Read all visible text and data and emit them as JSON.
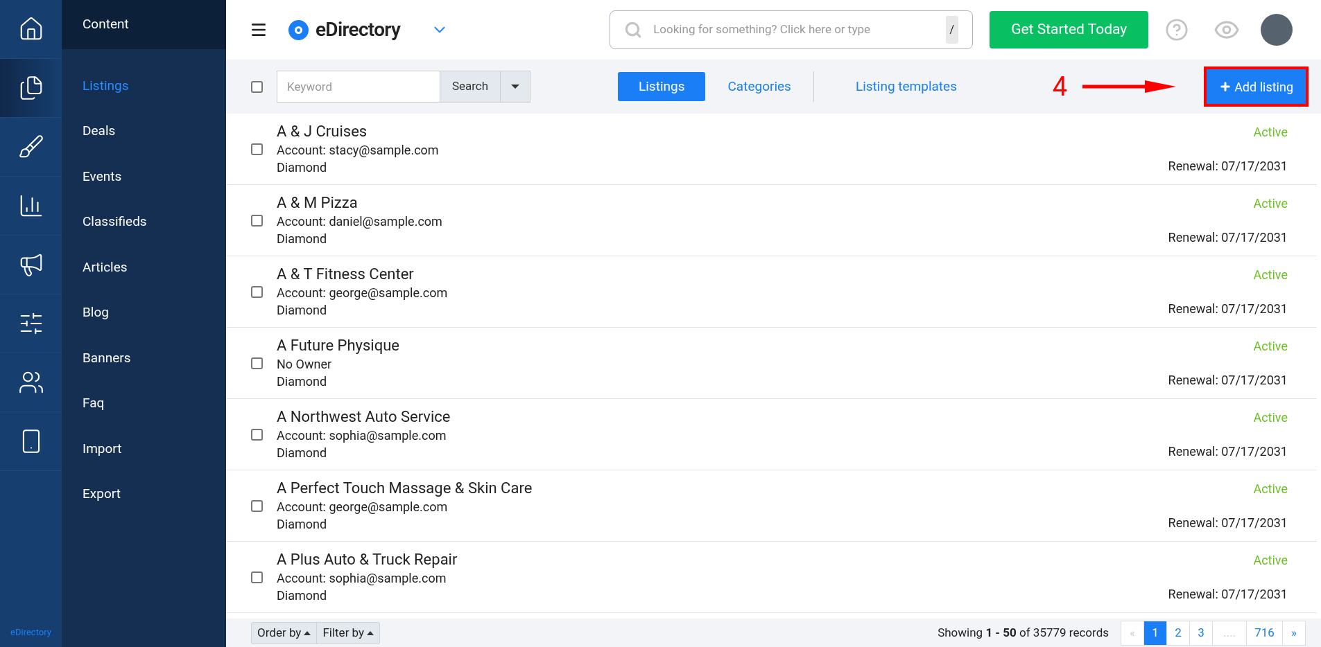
{
  "rail": {
    "items": [
      {
        "selected": false
      },
      {
        "selected": true
      },
      {
        "selected": false
      },
      {
        "selected": false
      },
      {
        "selected": false
      },
      {
        "selected": false
      },
      {
        "selected": false
      },
      {
        "selected": false
      }
    ],
    "footer": "eDirectory"
  },
  "sidebar": {
    "title": "Content",
    "items": [
      {
        "label": "Listings",
        "selected": true
      },
      {
        "label": "Deals",
        "selected": false
      },
      {
        "label": "Events",
        "selected": false
      },
      {
        "label": "Classifieds",
        "selected": false
      },
      {
        "label": "Articles",
        "selected": false
      },
      {
        "label": "Blog",
        "selected": false
      },
      {
        "label": "Banners",
        "selected": false
      },
      {
        "label": "Faq",
        "selected": false
      },
      {
        "label": "Import",
        "selected": false
      },
      {
        "label": "Export",
        "selected": false
      }
    ]
  },
  "topbar": {
    "brand": "eDirectory",
    "search": {
      "placeholder": "Looking for something? Click here or type",
      "key": "/"
    },
    "cta": "Get Started Today"
  },
  "toolbar": {
    "select_all": false,
    "keyword": {
      "placeholder": "Keyword"
    },
    "search_button": "Search",
    "tabs": [
      {
        "label": "Listings",
        "selected": true
      },
      {
        "label": "Categories",
        "selected": false
      },
      {
        "label": "Listing templates",
        "selected": false
      }
    ],
    "annotation": "4",
    "add_button": "Add listing"
  },
  "listings": [
    {
      "name": "A & J Cruises",
      "account": "Account: stacy@sample.com",
      "plan": "Diamond",
      "status": "Active",
      "renewal": "Renewal: 07/17/2031",
      "checked": false
    },
    {
      "name": "A & M Pizza",
      "account": "Account: daniel@sample.com",
      "plan": "Diamond",
      "status": "Active",
      "renewal": "Renewal: 07/17/2031",
      "checked": false
    },
    {
      "name": "A & T Fitness Center",
      "account": "Account: george@sample.com",
      "plan": "Diamond",
      "status": "Active",
      "renewal": "Renewal: 07/17/2031",
      "checked": false
    },
    {
      "name": "A Future Physique",
      "account": "No Owner",
      "plan": "Diamond",
      "status": "Active",
      "renewal": "Renewal: 07/17/2031",
      "checked": false
    },
    {
      "name": "A Northwest Auto Service",
      "account": "Account: sophia@sample.com",
      "plan": "Diamond",
      "status": "Active",
      "renewal": "Renewal: 07/17/2031",
      "checked": false
    },
    {
      "name": "A Perfect Touch Massage & Skin Care",
      "account": "Account: george@sample.com",
      "plan": "Diamond",
      "status": "Active",
      "renewal": "Renewal: 07/17/2031",
      "checked": false
    },
    {
      "name": "A Plus Auto & Truck Repair",
      "account": "Account: sophia@sample.com",
      "plan": "Diamond",
      "status": "Active",
      "renewal": "Renewal: 07/17/2031",
      "checked": false
    }
  ],
  "footer": {
    "order_by": "Order by",
    "filter_by": "Filter by",
    "summary": "Showing **1 - 50** of 35779 records",
    "pages": [
      {
        "label": "«",
        "kind": "prev",
        "selected": false
      },
      {
        "label": "1",
        "kind": "page",
        "selected": true
      },
      {
        "label": "2",
        "kind": "page",
        "selected": false
      },
      {
        "label": "3",
        "kind": "page",
        "selected": false
      },
      {
        "label": "....",
        "kind": "gap",
        "selected": false
      },
      {
        "label": "716",
        "kind": "page",
        "selected": false
      },
      {
        "label": "»",
        "kind": "next",
        "selected": false
      }
    ]
  }
}
